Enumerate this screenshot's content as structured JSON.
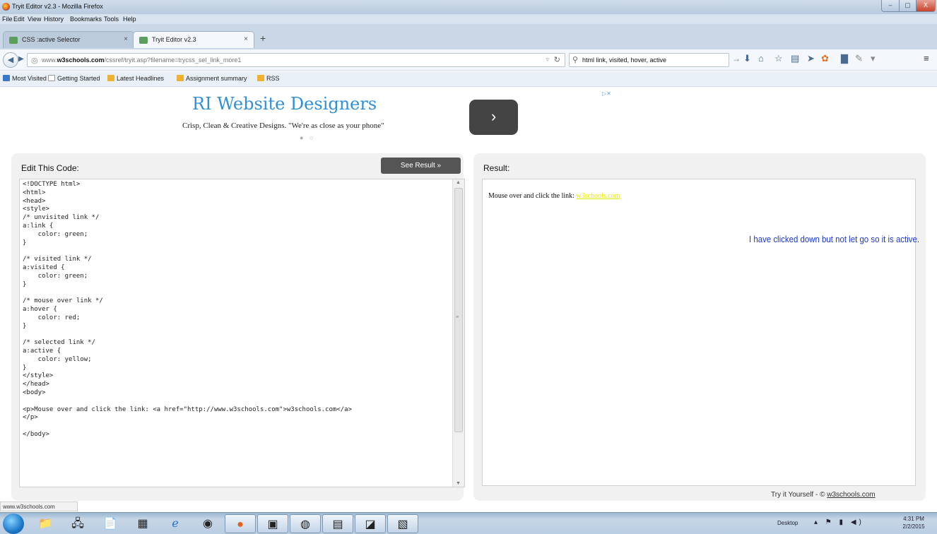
{
  "window": {
    "title": "Tryit Editor v2.3 - Mozilla Firefox",
    "minimize": "–",
    "maximize": "▢",
    "close": "X"
  },
  "menu": [
    "File",
    "Edit",
    "View",
    "History",
    "Bookmarks",
    "Tools",
    "Help"
  ],
  "tabs": [
    {
      "label": "CSS :active Selector",
      "close": "×"
    },
    {
      "label": "Tryit Editor v2.3",
      "close": "×"
    }
  ],
  "new_tab": "+",
  "nav": {
    "url_plain": "www.",
    "url_domain": "w3schools.com",
    "url_path": "/cssref/tryit.asp?filename=trycss_sel_link_more1",
    "search_value": "html link, visited, hover, active"
  },
  "bookmarks": [
    {
      "label": "Most Visited",
      "color": "#3a78c9"
    },
    {
      "label": "Getting Started",
      "color": "#ffffff"
    },
    {
      "label": "Latest Headlines",
      "color": "#f0b030"
    },
    {
      "label": "Assignment summary",
      "color": "#f0b030"
    },
    {
      "label": "RSS",
      "color": "#f0b030"
    }
  ],
  "ad": {
    "title": "RI Website Designers",
    "subtitle": "Crisp, Clean & Creative Designs. \"We're as close as your phone\"",
    "dots": "● ○",
    "next": "›",
    "choices": "▷✕"
  },
  "editor": {
    "heading": "Edit This Code:",
    "see_result": "See Result »",
    "code_lines": [
      "<!DOCTYPE html>",
      "<html>",
      "<head>",
      "<style>",
      "/* unvisited link */",
      "a:link {",
      "    color: green;",
      "}",
      "",
      "/* visited link */",
      "a:visited {",
      "    color: green;",
      "}",
      "",
      "/* mouse over link */",
      "a:hover {",
      "    color: red;",
      "}",
      "",
      "/* selected link */",
      "a:active {",
      "    color: yellow;",
      "}",
      "</style>",
      "</head>",
      "<body>",
      "",
      "<p>Mouse over and click the link: <a href=\"http://www.w3schools.com\">w3schools.com</a>",
      "</p>",
      "",
      "</body>"
    ]
  },
  "result": {
    "heading": "Result:",
    "text": "Mouse over and click the link: ",
    "link": "w3schools.com",
    "link_color": "#e6e600",
    "annotation": "I have clicked down but not let go so it is active.",
    "annotation_color": "#1c38d0",
    "footer_prefix": "Try it Yourself - © ",
    "footer_link": "w3schools.com"
  },
  "status_bar": "www.w3schools.com",
  "taskbar": {
    "apps": [
      "windows-explorer-icon",
      "network-icon",
      "document-icon",
      "calculator-icon",
      "internet-explorer-icon",
      "chrome-icon",
      "firefox-icon",
      "photo-icon",
      "app-icon",
      "word-icon",
      "notepad-icon",
      "certificate-icon"
    ],
    "desktop": "Desktop",
    "time": "4:31 PM",
    "date": "2/2/2015"
  }
}
